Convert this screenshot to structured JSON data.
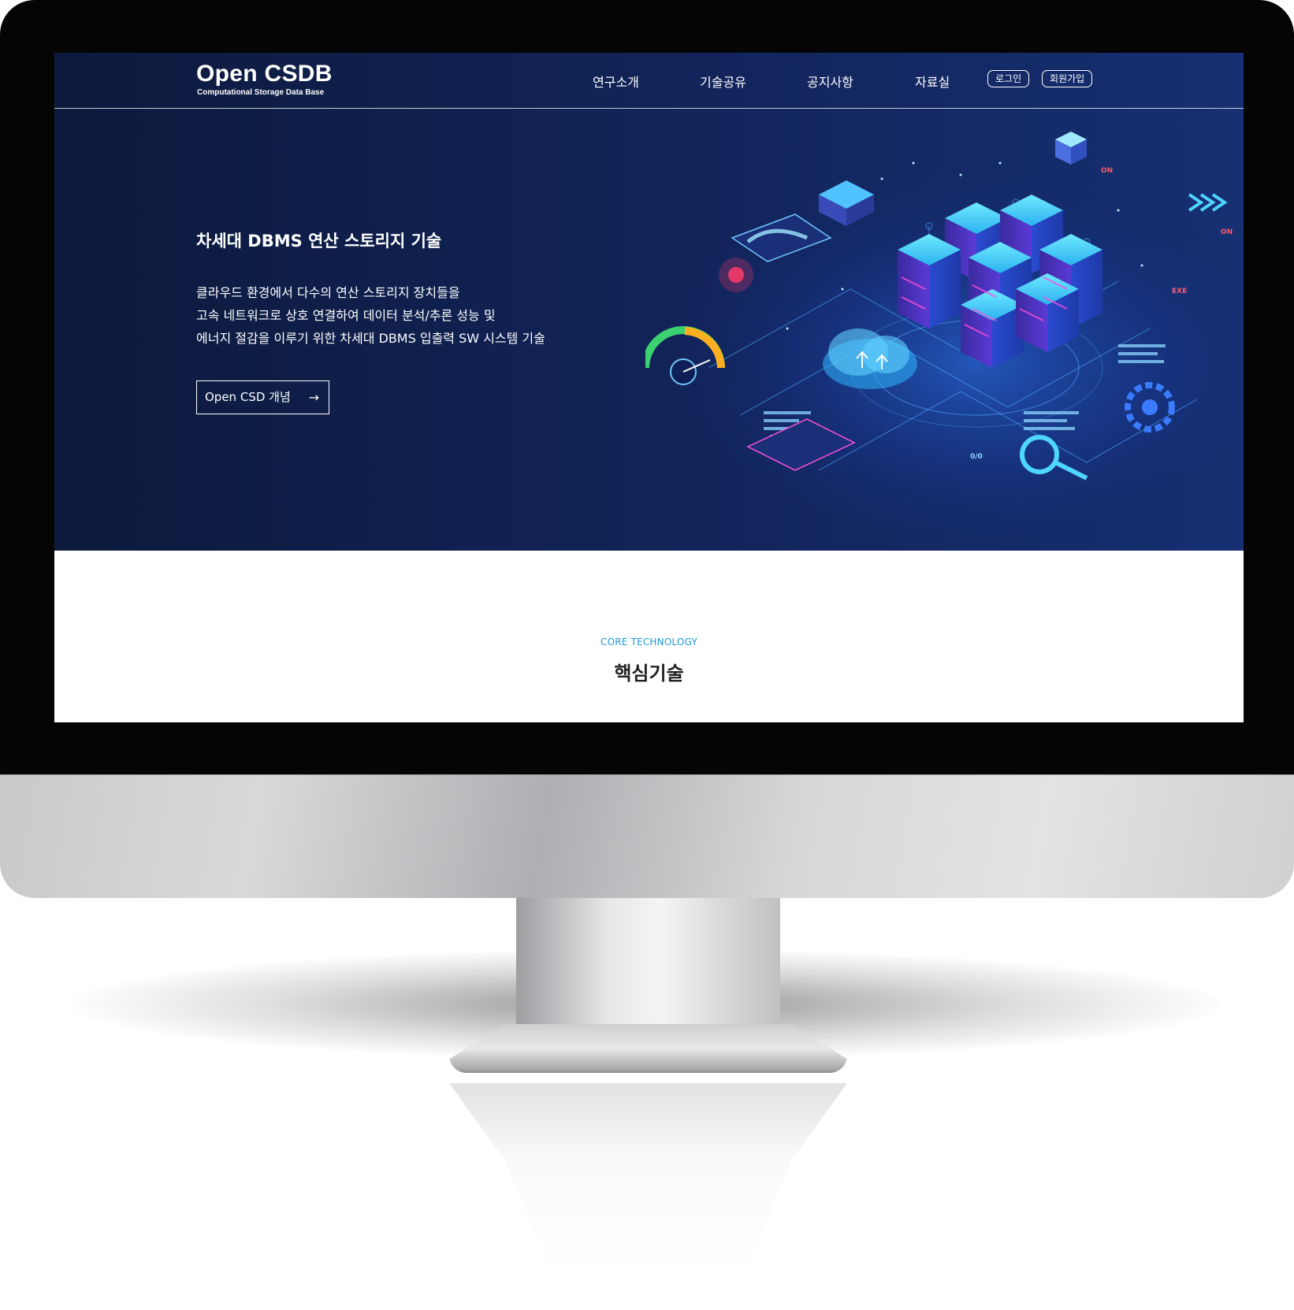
{
  "brand": {
    "title": "Open CSDB",
    "subtitle": "Computational Storage Data Base"
  },
  "nav": {
    "items": [
      {
        "label": "연구소개"
      },
      {
        "label": "기술공유"
      },
      {
        "label": "공지사항"
      },
      {
        "label": "자료실"
      }
    ],
    "login_label": "로그인",
    "signup_label": "회원가입"
  },
  "hero": {
    "title": "차세대 DBMS 연산 스토리지 기술",
    "description": [
      "클라우드 환경에서 다수의 연산 스토리지 장치들을",
      "고속 네트워크로 상호 연결하여 데이터 분석/추론 성능 및",
      "에너지 절감을 이루기 위한 차세대 DBMS 입출력 SW 시스템 기술"
    ],
    "cta_label": "Open CSD 개념",
    "cta_arrow": "→",
    "illustration_labels": {
      "on_badge": "ON",
      "exe_badge": "EXE",
      "code_tag": "0/0"
    }
  },
  "section": {
    "eyebrow": "CORE TECHNOLOGY",
    "title": "핵심기술"
  },
  "colors": {
    "hero_bg": "#12245a",
    "accent": "#1a9ad6",
    "bezel": "#050505"
  }
}
